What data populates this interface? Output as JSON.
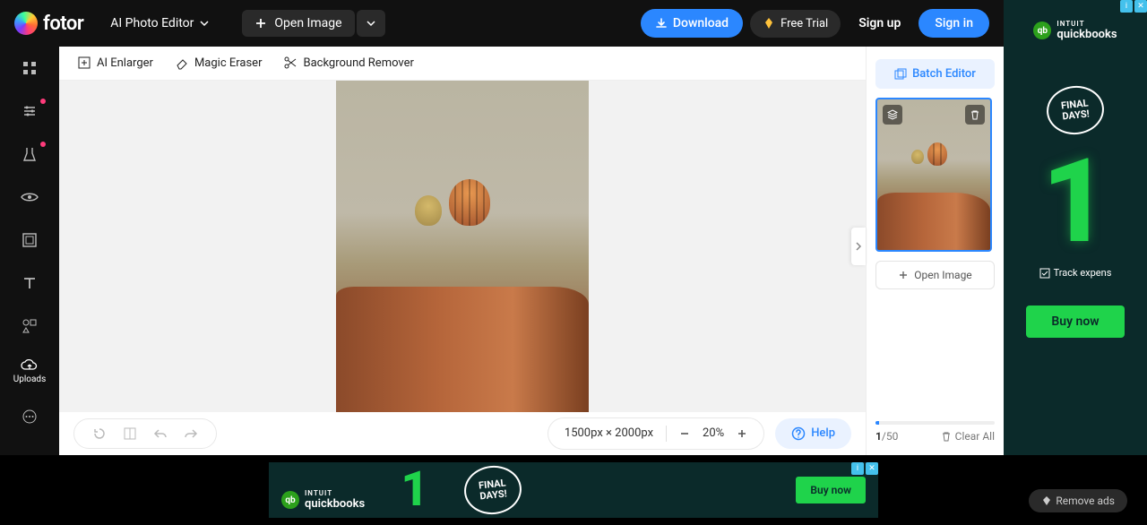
{
  "header": {
    "brand": "fotor",
    "mode_label": "AI Photo Editor",
    "open_image": "Open Image",
    "download": "Download",
    "free_trial": "Free Trial",
    "sign_up": "Sign up",
    "sign_in": "Sign in"
  },
  "rail": {
    "uploads_label": "Uploads"
  },
  "context": {
    "ai_enlarger": "AI Enlarger",
    "magic_eraser": "Magic Eraser",
    "bg_remover": "Background Remover"
  },
  "bottom": {
    "dimensions": "1500px × 2000px",
    "zoom": "20%",
    "help": "Help"
  },
  "right": {
    "batch": "Batch Editor",
    "open_image": "Open Image",
    "count_current": "1",
    "count_sep_total": "/50",
    "clear_all": "Clear All"
  },
  "ads": {
    "qb_brand_prefix": "INTUIT",
    "qb_brand": "quickbooks",
    "final_days": "FINAL DAYS!",
    "track": "Track expens",
    "buy_now": "Buy now",
    "remove": "Remove ads"
  }
}
